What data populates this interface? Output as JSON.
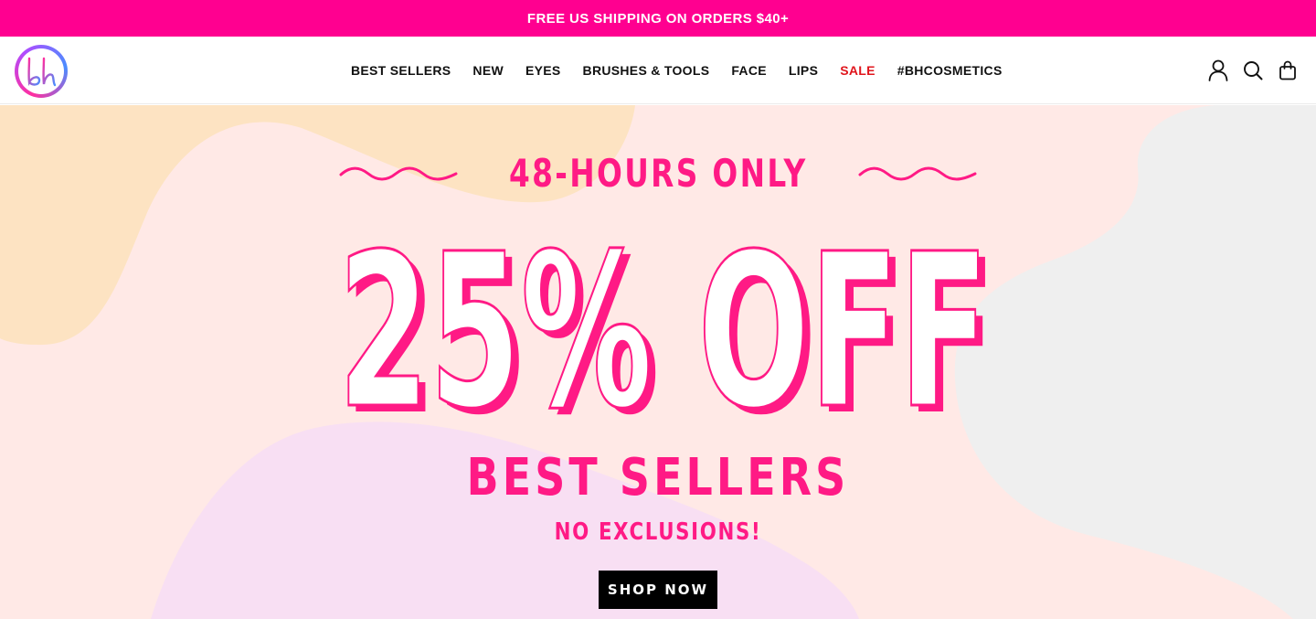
{
  "announcement": {
    "text": "FREE US SHIPPING ON ORDERS $40+"
  },
  "brand": {
    "logo_text": "bh"
  },
  "nav": {
    "items": [
      {
        "label": "BEST SELLERS"
      },
      {
        "label": "NEW"
      },
      {
        "label": "EYES"
      },
      {
        "label": "BRUSHES & TOOLS"
      },
      {
        "label": "FACE"
      },
      {
        "label": "LIPS"
      },
      {
        "label": "SALE",
        "color": "#e0151c"
      },
      {
        "label": "#BHCOSMETICS"
      }
    ]
  },
  "header_icons": [
    "account-icon",
    "search-icon",
    "cart-icon"
  ],
  "hero": {
    "eyebrow": "48-HOURS ONLY",
    "headline": "25% OFF",
    "subheading": "BEST SELLERS",
    "tagline": "NO EXCLUSIONS!",
    "cta_label": "SHOP NOW"
  },
  "colors": {
    "brand_pink": "#ff0090",
    "hero_pink": "#ff1a85",
    "sale_red": "#e0151c",
    "hero_bg": "#ffe9e6",
    "blob_peach": "#fde3c2",
    "blob_gray": "#efefef",
    "blob_lavender": "#f8dff3",
    "cta_bg": "#000000"
  }
}
